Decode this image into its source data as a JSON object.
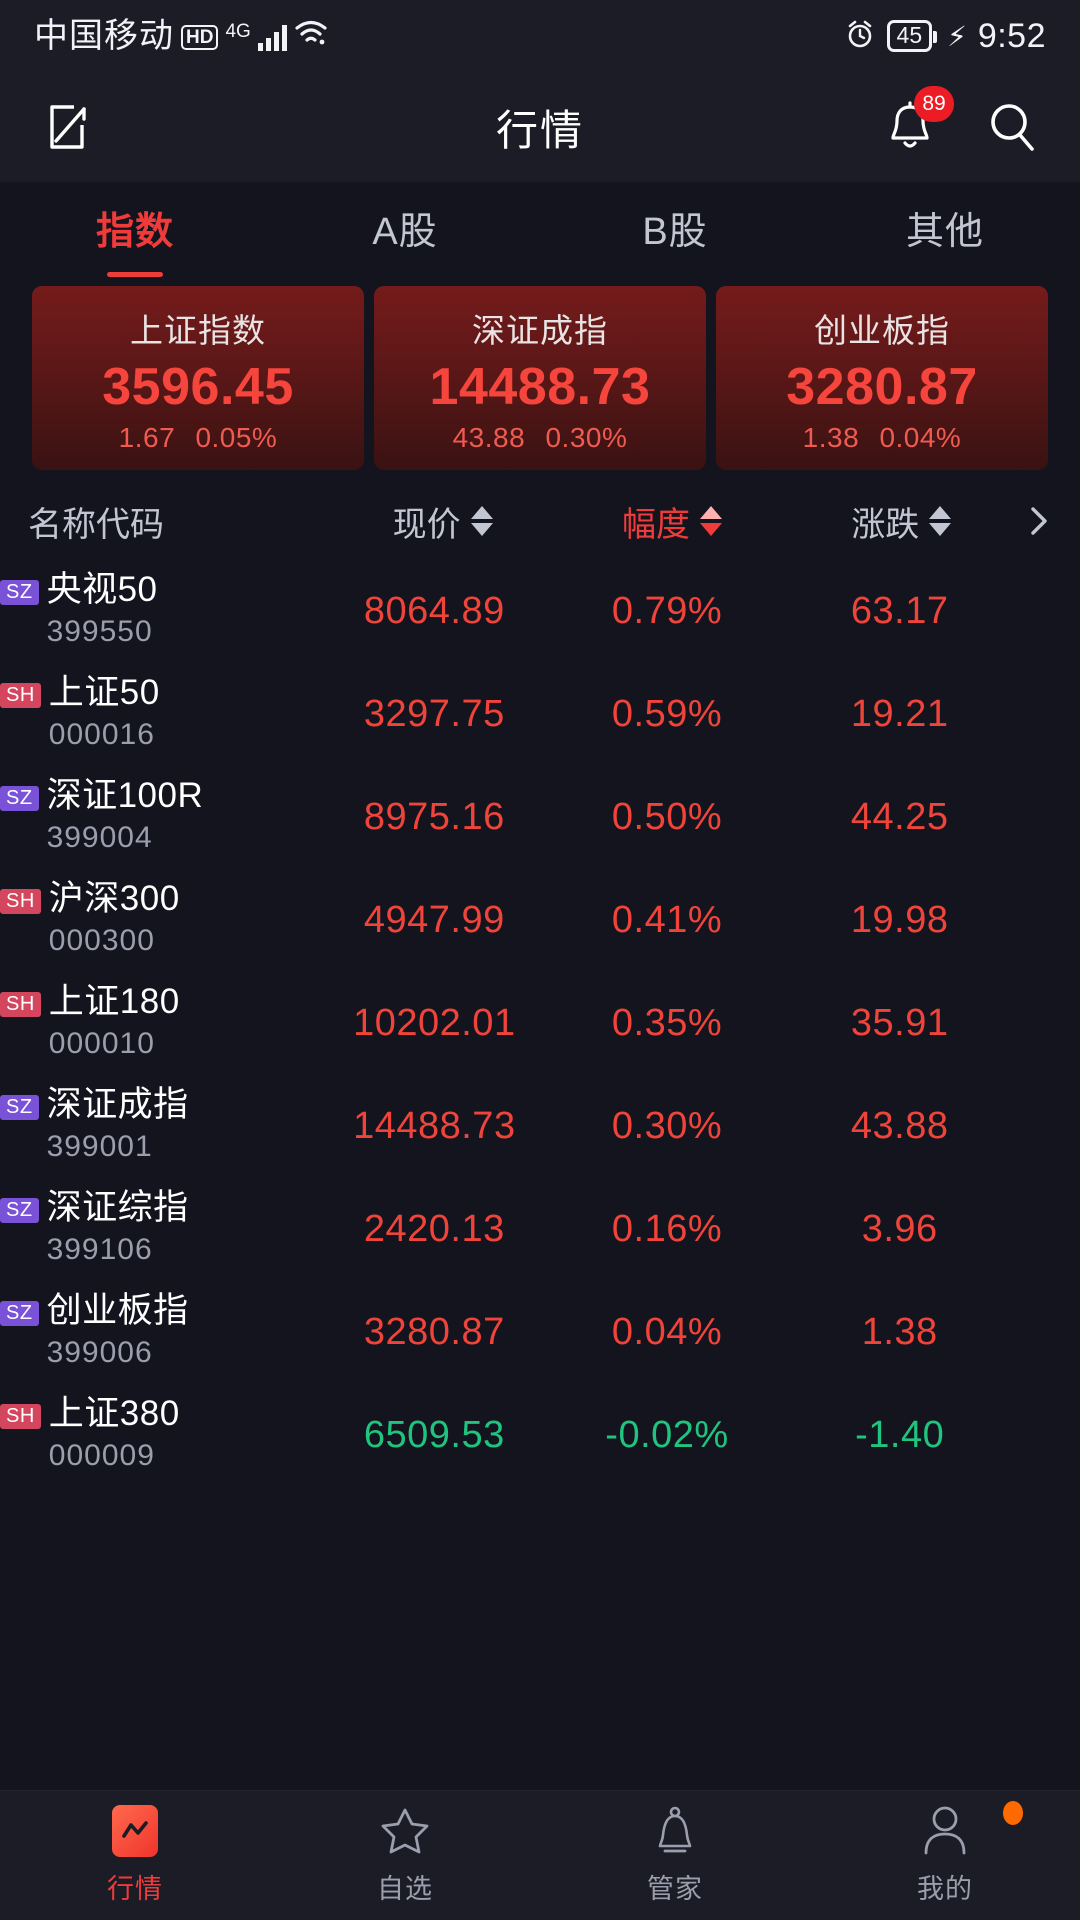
{
  "statusbar": {
    "carrier": "中国移动",
    "hd": "HD",
    "network": "4G",
    "battery": "45",
    "time": "9:52",
    "alarm_icon": "alarm-clock-icon",
    "bolt_icon": "charging-bolt-icon",
    "signal_icon": "signal-bars-icon",
    "wifi_icon": "wifi-icon"
  },
  "header": {
    "title": "行情",
    "compose_icon": "compose-edit-icon",
    "bell_icon": "notification-bell-icon",
    "search_icon": "search-icon",
    "notification_count": "89"
  },
  "tabs": [
    {
      "label": "指数",
      "active": true
    },
    {
      "label": "A股",
      "active": false
    },
    {
      "label": "B股",
      "active": false
    },
    {
      "label": "其他",
      "active": false
    }
  ],
  "index_cards": [
    {
      "name": "上证指数",
      "value": "3596.45",
      "change": "1.67",
      "percent": "0.05%"
    },
    {
      "name": "深证成指",
      "value": "14488.73",
      "change": "43.88",
      "percent": "0.30%"
    },
    {
      "name": "创业板指",
      "value": "3280.87",
      "change": "1.38",
      "percent": "0.04%"
    }
  ],
  "table": {
    "columns": [
      {
        "label": "名称代码",
        "sortable": false,
        "sorted": false
      },
      {
        "label": "现价",
        "sortable": true,
        "sorted": false
      },
      {
        "label": "幅度",
        "sortable": true,
        "sorted": true
      },
      {
        "label": "涨跌",
        "sortable": true,
        "sorted": false
      }
    ],
    "more_icon": "chevron-right-icon",
    "rows": [
      {
        "exchange": "SZ",
        "name": "央视50",
        "code": "399550",
        "price": "8064.89",
        "percent": "0.79%",
        "change": "63.17",
        "direction": "up"
      },
      {
        "exchange": "SH",
        "name": "上证50",
        "code": "000016",
        "price": "3297.75",
        "percent": "0.59%",
        "change": "19.21",
        "direction": "up"
      },
      {
        "exchange": "SZ",
        "name": "深证100R",
        "code": "399004",
        "price": "8975.16",
        "percent": "0.50%",
        "change": "44.25",
        "direction": "up"
      },
      {
        "exchange": "SH",
        "name": "沪深300",
        "code": "000300",
        "price": "4947.99",
        "percent": "0.41%",
        "change": "19.98",
        "direction": "up"
      },
      {
        "exchange": "SH",
        "name": "上证180",
        "code": "000010",
        "price": "10202.01",
        "percent": "0.35%",
        "change": "35.91",
        "direction": "up"
      },
      {
        "exchange": "SZ",
        "name": "深证成指",
        "code": "399001",
        "price": "14488.73",
        "percent": "0.30%",
        "change": "43.88",
        "direction": "up"
      },
      {
        "exchange": "SZ",
        "name": "深证综指",
        "code": "399106",
        "price": "2420.13",
        "percent": "0.16%",
        "change": "3.96",
        "direction": "up"
      },
      {
        "exchange": "SZ",
        "name": "创业板指",
        "code": "399006",
        "price": "3280.87",
        "percent": "0.04%",
        "change": "1.38",
        "direction": "up"
      },
      {
        "exchange": "SH",
        "name": "上证380",
        "code": "000009",
        "price": "6509.53",
        "percent": "-0.02%",
        "change": "-1.40",
        "direction": "down"
      }
    ]
  },
  "bottomnav": [
    {
      "label": "行情",
      "icon": "market-chart-icon",
      "active": true,
      "dot": false
    },
    {
      "label": "自选",
      "icon": "star-icon",
      "active": false,
      "dot": false
    },
    {
      "label": "管家",
      "icon": "bell-butler-icon",
      "active": false,
      "dot": false
    },
    {
      "label": "我的",
      "icon": "person-icon",
      "active": false,
      "dot": true
    }
  ],
  "colors": {
    "up": "#f0443a",
    "down": "#1fc47e",
    "accent": "#f03b3b",
    "bg": "#13141d",
    "bar_bg": "#1b1c25",
    "sz_badge": "#7a52d8",
    "sh_badge": "#d4465e"
  }
}
